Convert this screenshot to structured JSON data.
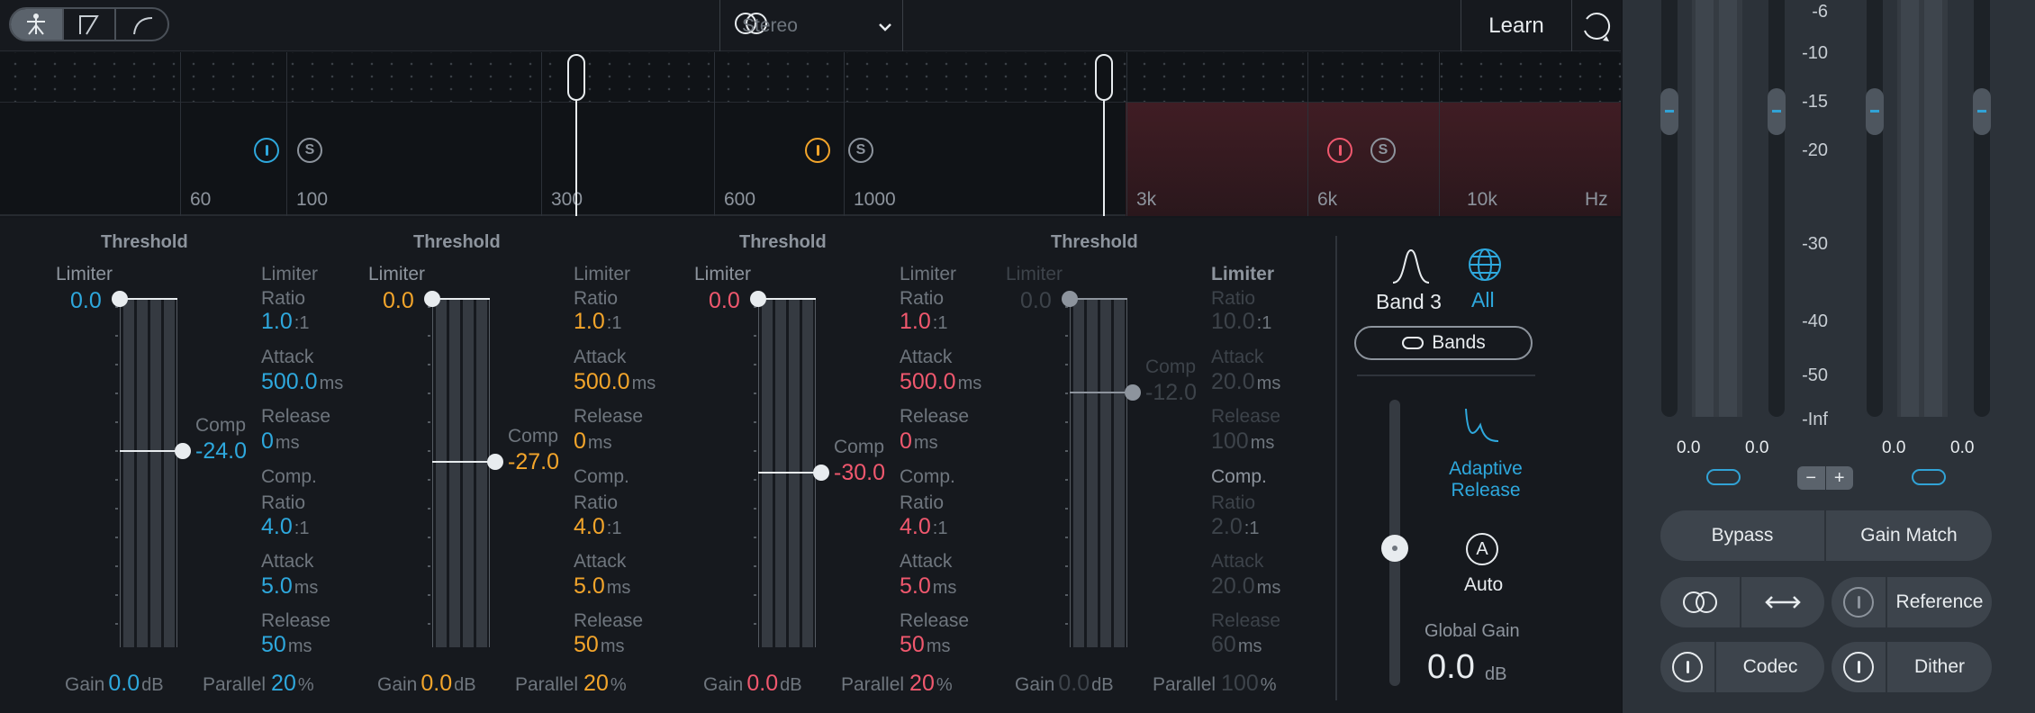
{
  "topbar": {
    "mode_icons": [
      "sprite-icon",
      "bell-filter-icon",
      "curve-icon"
    ],
    "stereo_label": "Stereo",
    "learn_label": "Learn",
    "history_icon": "history-icon"
  },
  "spectrum": {
    "freq_labels": [
      "60",
      "100",
      "300",
      "600",
      "1000",
      "3k",
      "6k",
      "10k",
      "Hz"
    ],
    "solo_letter": "S"
  },
  "bands": [
    {
      "color": "#2ea8dd",
      "threshold_label": "Threshold",
      "limiter_label": "Limiter",
      "limiter_value": "0.0",
      "comp_label": "Comp",
      "comp_value": "-24.0",
      "limiter_ratio_label": "Limiter",
      "ratio_label": "Ratio",
      "limiter_ratio": "1.0",
      "ratio_suffix": ":1",
      "attack_label": "Attack",
      "limiter_attack": "500.0",
      "ms": "ms",
      "release_label": "Release",
      "limiter_release": "0",
      "comp_ratio_label": "Comp.",
      "comp_ratio": "4.0",
      "comp_attack": "5.0",
      "comp_release": "50",
      "gain_label": "Gain",
      "gain_value": "0.0",
      "db": "dB",
      "parallel_label": "Parallel",
      "parallel_value": "20",
      "pct": "%"
    },
    {
      "color": "#f3a52b",
      "threshold_label": "Threshold",
      "limiter_label": "Limiter",
      "limiter_value": "0.0",
      "comp_label": "Comp",
      "comp_value": "-27.0",
      "limiter_ratio_label": "Limiter",
      "ratio_label": "Ratio",
      "limiter_ratio": "1.0",
      "ratio_suffix": ":1",
      "attack_label": "Attack",
      "limiter_attack": "500.0",
      "ms": "ms",
      "release_label": "Release",
      "limiter_release": "0",
      "comp_ratio_label": "Comp.",
      "comp_ratio": "4.0",
      "comp_attack": "5.0",
      "comp_release": "50",
      "gain_label": "Gain",
      "gain_value": "0.0",
      "db": "dB",
      "parallel_label": "Parallel",
      "parallel_value": "20",
      "pct": "%"
    },
    {
      "color": "#f0586e",
      "threshold_label": "Threshold",
      "limiter_label": "Limiter",
      "limiter_value": "0.0",
      "comp_label": "Comp",
      "comp_value": "-30.0",
      "limiter_ratio_label": "Limiter",
      "ratio_label": "Ratio",
      "limiter_ratio": "1.0",
      "ratio_suffix": ":1",
      "attack_label": "Attack",
      "limiter_attack": "500.0",
      "ms": "ms",
      "release_label": "Release",
      "limiter_release": "0",
      "comp_ratio_label": "Comp.",
      "comp_ratio": "4.0",
      "comp_attack": "5.0",
      "comp_release": "50",
      "gain_label": "Gain",
      "gain_value": "0.0",
      "db": "dB",
      "parallel_label": "Parallel",
      "parallel_value": "20",
      "pct": "%"
    },
    {
      "color": "#3d434a",
      "threshold_label": "Threshold",
      "limiter_label": "Limiter",
      "limiter_value": "0.0",
      "comp_label": "Comp",
      "comp_value": "-12.0",
      "limiter_ratio_label": "Limiter",
      "ratio_label": "Ratio",
      "limiter_ratio": "10.0",
      "ratio_suffix": ":1",
      "attack_label": "Attack",
      "limiter_attack": "20.0",
      "ms": "ms",
      "release_label": "Release",
      "limiter_release": "100",
      "comp_ratio_label": "Comp.",
      "comp_ratio": "2.0",
      "comp_attack": "20.0",
      "comp_release": "60",
      "gain_label": "Gain",
      "gain_value": "0.0",
      "db": "dB",
      "parallel_label": "Parallel",
      "parallel_value": "100",
      "pct": "%"
    }
  ],
  "side": {
    "band_label": "Band 3",
    "all_label": "All",
    "bands_button": "Bands",
    "adaptive_label": "Adaptive",
    "release_label": "Release",
    "auto_letter": "A",
    "auto_label": "Auto",
    "global_gain_label": "Global Gain",
    "global_gain_value": "0.0",
    "db": "dB"
  },
  "right_panel": {
    "scale": [
      "-6",
      "-10",
      "-15",
      "-20",
      "-30",
      "-40",
      "-50",
      "-Inf"
    ],
    "left_in": "0.0",
    "right_in": "0.0",
    "left_out": "0.0",
    "right_out": "0.0",
    "minus": "−",
    "plus": "+",
    "bypass": "Bypass",
    "gain_match": "Gain Match",
    "reference": "Reference",
    "codec": "Codec",
    "dither": "Dither"
  }
}
